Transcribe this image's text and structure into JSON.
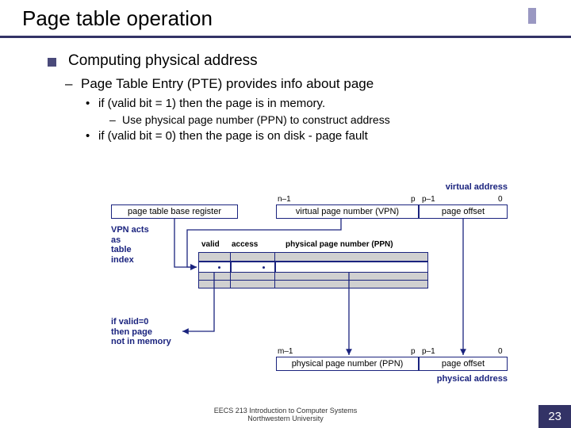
{
  "title": "Page table operation",
  "bullets": {
    "b1": "Computing physical address",
    "b2": "Page Table Entry (PTE) provides info about page",
    "b3": "if (valid bit = 1) then the page is in memory.",
    "b4": "Use physical page number (PPN) to construct address",
    "b5": "if (valid bit = 0) then the page is on disk - page fault"
  },
  "diagram": {
    "virtual_address": "virtual address",
    "ptbr": "page table base register",
    "vpn_acts": "VPN acts\nas\ntable\nindex",
    "vpn": "virtual page number (VPN)",
    "page_offset": "page offset",
    "valid": "valid",
    "access": "access",
    "ppn_hdr": "physical page number (PPN)",
    "if_valid0": "if valid=0\nthen page\nnot in memory",
    "ppn_box": "physical page number (PPN)",
    "physical_address": "physical address",
    "n1": "n–1",
    "p": "p",
    "p1": "p–1",
    "zero": "0",
    "m1": "m–1"
  },
  "footer": {
    "line1": "EECS 213 Introduction to Computer Systems",
    "line2": "Northwestern University"
  },
  "page_number": "23"
}
